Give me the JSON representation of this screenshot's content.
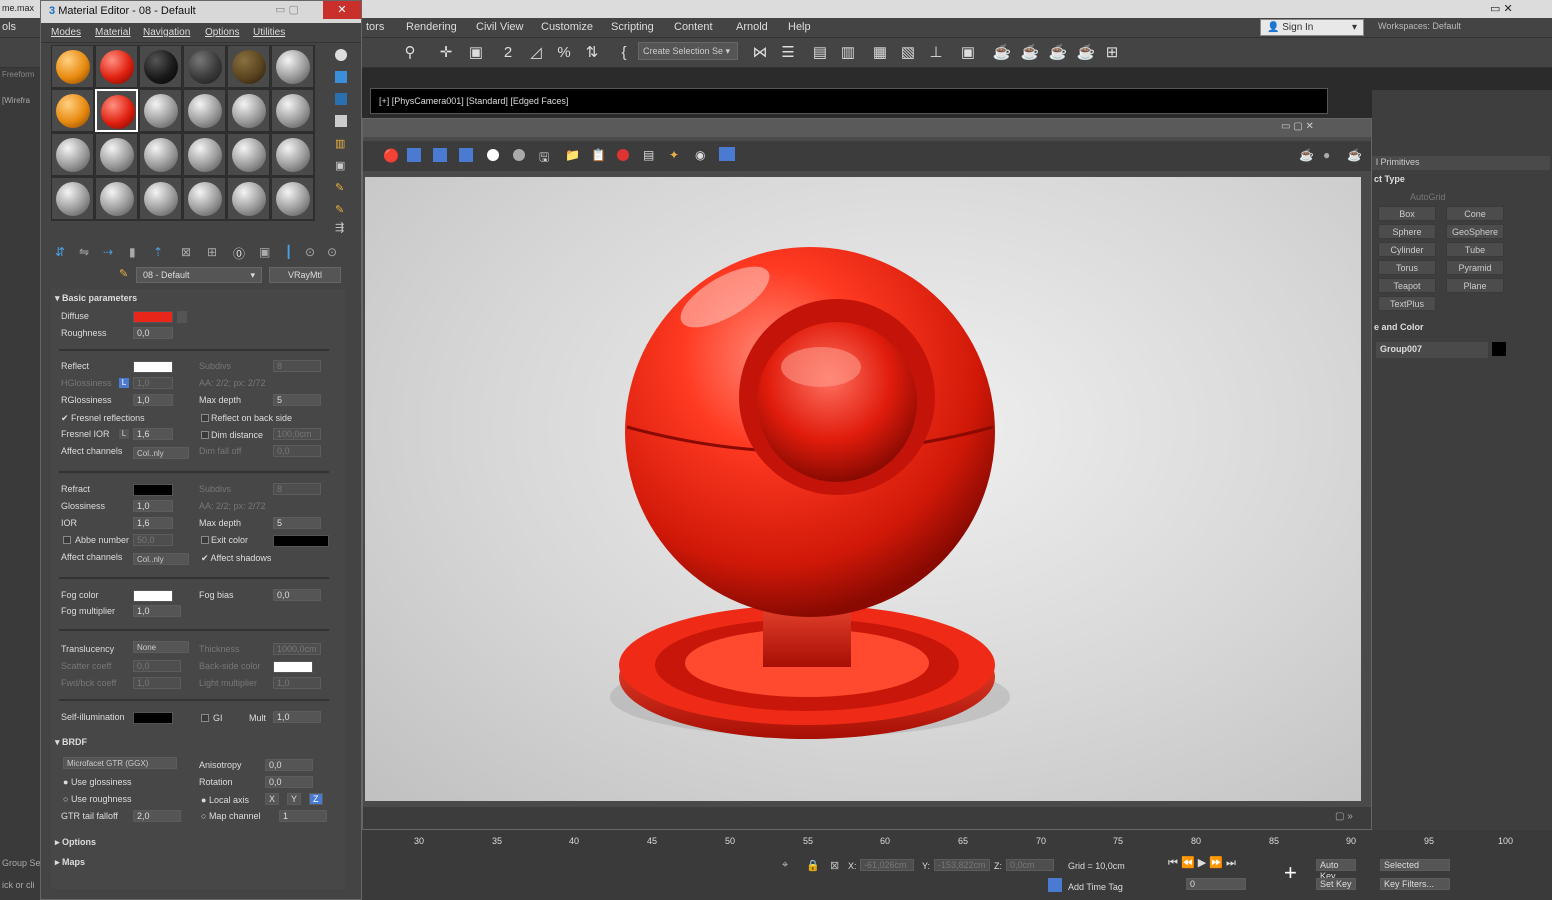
{
  "app": {
    "file_name": "me.max",
    "menus": [
      "tors",
      "Rendering",
      "Civil View",
      "Customize",
      "Scripting",
      "Content",
      "Arnold",
      "Help"
    ],
    "left_menu_fragment": "ols",
    "signin": "Sign In",
    "workspaces_label": "Workspaces:",
    "workspaces_value": "Default",
    "selection_set_placeholder": "Create Selection Se",
    "left_tabs": [
      "Freeform",
      "[Wirefra"
    ]
  },
  "viewport": {
    "label": "[+] [PhysCamera001] [Standard] [Edged Faces]",
    "accent_color": "#ff2a1a"
  },
  "command_panel": {
    "category": "l Primitives",
    "object_type_title": "ct Type",
    "autogrid": "AutoGrid",
    "buttons": [
      "Box",
      "Cone",
      "Sphere",
      "GeoSphere",
      "Cylinder",
      "Tube",
      "Torus",
      "Pyramid",
      "Teapot",
      "Plane",
      "TextPlus"
    ],
    "name_color_title": "e and Color",
    "object_name": "Group007"
  },
  "timeline": {
    "ticks": [
      "30",
      "35",
      "40",
      "45",
      "50",
      "55",
      "60",
      "65",
      "70",
      "75",
      "80",
      "85",
      "90",
      "95",
      "100"
    ]
  },
  "status": {
    "left_text_1": "Group Se",
    "left_text_2": "ick or cli",
    "x_label": "X:",
    "x_value": "-61,026cm",
    "y_label": "Y:",
    "y_value": "-153,822cm",
    "z_label": "Z:",
    "z_value": "0,0cm",
    "grid": "Grid = 10,0cm",
    "add_time_tag": "Add Time Tag",
    "auto_key": "Auto Key",
    "set_key": "Set Key",
    "selected": "Selected",
    "frame": "0",
    "key_filters": "Key Filters..."
  },
  "material_editor": {
    "title": "Material Editor - 08 - Default",
    "menus": [
      "Modes",
      "Material",
      "Navigation",
      "Options",
      "Utilities"
    ],
    "slots": [
      [
        "orange",
        "red",
        "black",
        "dark",
        "brown",
        "grey"
      ],
      [
        "orange",
        "red",
        "grey",
        "grey",
        "grey",
        "grey"
      ],
      [
        "grey",
        "grey",
        "grey",
        "grey",
        "grey",
        "grey"
      ],
      [
        "grey",
        "grey",
        "grey",
        "grey",
        "grey",
        "grey"
      ]
    ],
    "material_name": "08 - Default",
    "material_type": "VRayMtl",
    "basic": {
      "title": "Basic parameters",
      "diffuse": "Diffuse",
      "diffuse_color": "#e8261a",
      "roughness": "Roughness",
      "roughness_val": "0,0",
      "reflect": "Reflect",
      "subdivs": "Subdivs",
      "subdivs_val": "8",
      "hglossiness": "HGlossiness",
      "hgloss_val": "1,0",
      "aa": "AA: 2/2; px: 2/72",
      "rglossiness": "RGlossiness",
      "rgloss_val": "1,0",
      "max_depth": "Max depth",
      "max_depth_val": "5",
      "fresnel": "Fresnel reflections",
      "reflect_back": "Reflect on back side",
      "fresnel_ior": "Fresnel IOR",
      "fresnel_ior_val": "1,6",
      "dim_distance": "Dim distance",
      "dim_distance_val": "100,0cm",
      "affect_channels": "Affect channels",
      "affect_val": "Col..nly",
      "dim_falloff": "Dim fall off",
      "dim_falloff_val": "0,0",
      "refract": "Refract",
      "r_subdivs_val": "8",
      "glossiness": "Glossiness",
      "gloss_val": "1,0",
      "r_aa": "AA: 2/2; px: 2/72",
      "ior": "IOR",
      "ior_val": "1,6",
      "r_max_depth_val": "5",
      "abbe": "Abbe number",
      "abbe_val": "50,0",
      "exit_color": "Exit color",
      "affect_shadows": "Affect shadows",
      "r_affect_val": "Col..nly",
      "fog_color": "Fog color",
      "fog_bias": "Fog bias",
      "fog_bias_val": "0,0",
      "fog_mult": "Fog multiplier",
      "fog_mult_val": "1,0",
      "translucency": "Translucency",
      "translucency_val": "None",
      "thickness": "Thickness",
      "thickness_val": "1000,0cm",
      "scatter": "Scatter coeff",
      "scatter_val": "0,0",
      "back_side": "Back-side color",
      "fwd": "Fwd/bck coeff",
      "fwd_val": "1,0",
      "light_mult": "Light multiplier",
      "light_mult_val": "1,0",
      "self_illum": "Self-illumination",
      "gi": "GI",
      "mult": "Mult",
      "mult_val": "1,0"
    },
    "brdf": {
      "title": "BRDF",
      "type": "Microfacet GTR (GGX)",
      "anisotropy": "Anisotropy",
      "aniso_val": "0,0",
      "use_gloss": "Use glossiness",
      "rotation": "Rotation",
      "rotation_val": "0,0",
      "use_rough": "Use roughness",
      "local_axis": "Local axis",
      "axes": [
        "X",
        "Y",
        "Z"
      ],
      "gtr": "GTR tail falloff",
      "gtr_val": "2,0",
      "map_channel": "Map channel",
      "map_channel_val": "1"
    },
    "options_title": "Options",
    "maps_title": "Maps"
  }
}
